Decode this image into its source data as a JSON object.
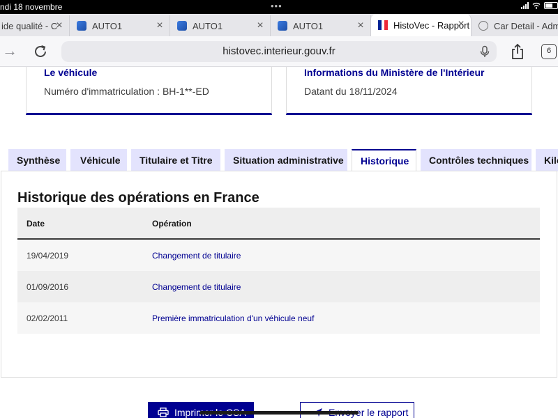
{
  "statusbar": {
    "date": "ndi 18 novembre",
    "battery": "5"
  },
  "browser_tabs": [
    {
      "label": "ide qualité - C",
      "favicon": "auto1-icon"
    },
    {
      "label": "AUTO1",
      "favicon": "auto1-icon"
    },
    {
      "label": "AUTO1",
      "favicon": "auto1-icon"
    },
    {
      "label": "AUTO1",
      "favicon": "auto1-icon"
    },
    {
      "label": "HistoVec - Rapport",
      "favicon": "french-flag-icon",
      "active": true
    },
    {
      "label": "Car Detail - Admin",
      "favicon": "globe-icon"
    }
  ],
  "address": {
    "url": "histovec.interieur.gouv.fr",
    "tab_count": "6"
  },
  "cards": [
    {
      "title": "Le véhicule",
      "value": "Numéro d'immatriculation : BH-1**-ED"
    },
    {
      "title": "Informations du Ministère de l'Intérieur",
      "value": "Datant du 18/11/2024"
    }
  ],
  "page_tabs": [
    {
      "label": "Synthèse"
    },
    {
      "label": "Véhicule"
    },
    {
      "label": "Titulaire et Titre"
    },
    {
      "label": "Situation administrative"
    },
    {
      "label": "Historique",
      "selected": true
    },
    {
      "label": "Contrôles techniques"
    },
    {
      "label": "Kilométrage"
    }
  ],
  "history": {
    "title": "Historique des opérations en France",
    "columns": {
      "date": "Date",
      "operation": "Opération"
    },
    "rows": [
      {
        "date": "19/04/2019",
        "operation": "Changement de titulaire"
      },
      {
        "date": "01/09/2016",
        "operation": "Changement de titulaire"
      },
      {
        "date": "02/02/2011",
        "operation": "Première immatriculation d'un véhicule neuf"
      }
    ]
  },
  "actions": {
    "print_label": "Imprimer le CSA",
    "send_label": "Envoyer le rapport"
  },
  "colors": {
    "primary": "#000091",
    "tab_bg": "#e3e3fd",
    "flag_blue": "#002395",
    "flag_red": "#ed2939"
  }
}
